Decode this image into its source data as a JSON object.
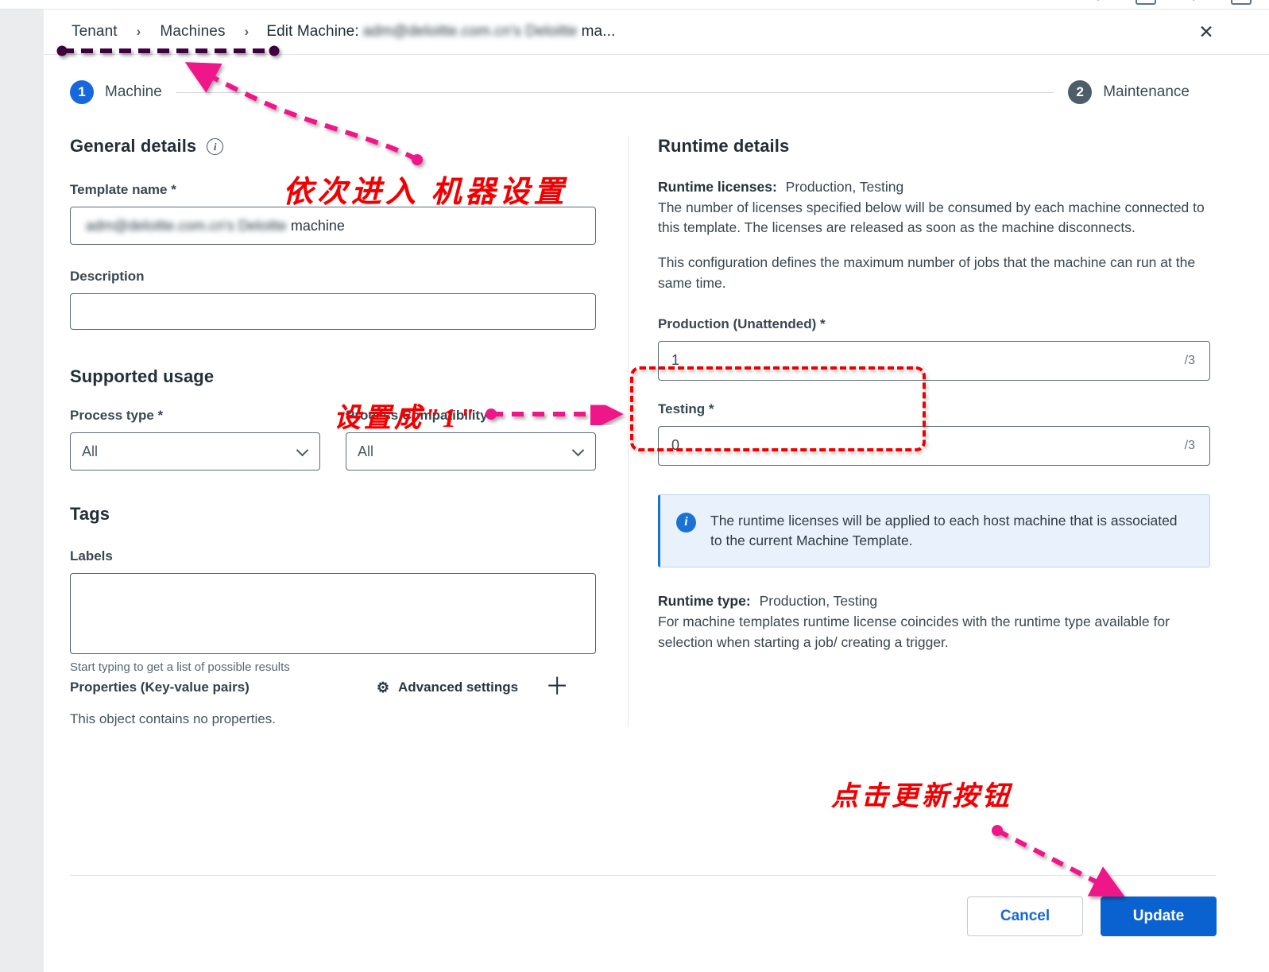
{
  "window": {
    "close_label": "✕"
  },
  "breadcrumb": {
    "items": [
      {
        "label": "Tenant",
        "type": "link"
      },
      {
        "label": "Machines",
        "type": "link"
      }
    ],
    "separator": "›",
    "current_prefix": "Edit Machine:",
    "current_redacted": "adm@deloitte.com.cn's Deloitte",
    "current_suffix": "ma..."
  },
  "stepper": {
    "steps": [
      {
        "number": "1",
        "label": "Machine",
        "state": "active"
      },
      {
        "number": "2",
        "label": "Maintenance",
        "state": "inactive"
      }
    ]
  },
  "general": {
    "title": "General details",
    "info_icon_glyph": "i",
    "template_name_label": "Template name *",
    "template_name_redacted": "adm@deloitte.com.cn's Deloitte",
    "template_name_suffix": "machine",
    "description_label": "Description",
    "description_value": ""
  },
  "supported_usage": {
    "title": "Supported usage",
    "process_type_label": "Process type *",
    "process_type_value": "All",
    "process_compat_label": "Process Compatibility *",
    "process_compat_value": "All"
  },
  "tags": {
    "title": "Tags",
    "labels_label": "Labels",
    "labels_value": "",
    "hint": "Start typing to get a list of possible results",
    "properties_title": "Properties (Key-value pairs)",
    "advanced_settings_label": "Advanced settings",
    "gear_icon_glyph": "⚙",
    "add_icon_glyph": "＋",
    "no_properties_text": "This object contains no properties."
  },
  "runtime": {
    "title": "Runtime details",
    "licenses_heading": "Runtime licenses:",
    "licenses_value": "Production, Testing",
    "licenses_para_1": "The number of licenses specified below will be consumed by each machine connected to this template. The licenses are released as soon as the machine disconnects.",
    "licenses_para_2": "This configuration defines the maximum number of jobs that the machine can run at the same time.",
    "production_label": "Production (Unattended) *",
    "production_value": "1",
    "production_max": "/3",
    "testing_label": "Testing *",
    "testing_value": "0",
    "testing_max": "/3",
    "banner_icon_glyph": "i",
    "banner_text": "The runtime licenses will be applied to each host machine that is associated to the current Machine Template.",
    "type_heading": "Runtime type:",
    "type_value": "Production, Testing",
    "type_para": "For machine templates runtime license coincides with the runtime type available for selection when starting a job/ creating a trigger."
  },
  "footer": {
    "cancel_label": "Cancel",
    "update_label": "Update"
  },
  "annotations": {
    "note_1": "依次进入 机器设置",
    "note_2": "设置成\"1\"",
    "note_3": "点击更新按钮"
  },
  "colors": {
    "accent_blue": "#0a62d0",
    "step_active": "#1668dc",
    "step_inactive": "#4d5e69",
    "annotation_red": "#f00000",
    "annotation_pink": "#ef1389",
    "annotation_purple": "#40003f",
    "banner_bg": "#e9f2fc"
  }
}
